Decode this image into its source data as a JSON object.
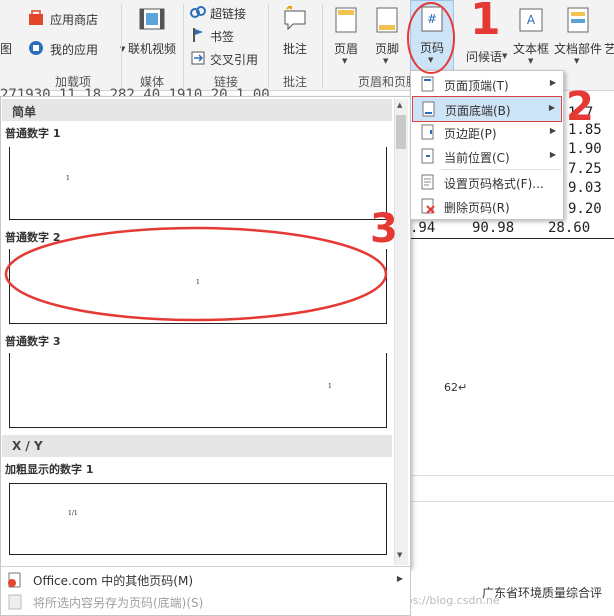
{
  "ribbon": {
    "cut_left_label": "图",
    "store": "应用商店",
    "my_apps": "我的应用",
    "addins_group": "加载项",
    "online_video": "联机视频",
    "media_group": "媒体",
    "hyperlink": "超链接",
    "bookmark": "书签",
    "cross_ref": "交叉引用",
    "links_group": "链接",
    "comment": "批注",
    "comments_group": "批注",
    "header": "页眉",
    "footer": "页脚",
    "page_number": "页码",
    "header_footer_group": "页眉和页脚",
    "greeting": "问候语",
    "textbox": "文本框",
    "quickparts": "文档部件",
    "more_cut": "艺"
  },
  "document": {
    "row1": ".94",
    "row1_b": "90.98",
    "row1_c": "28.60",
    "col_values": [
      "1.7",
      "1.85",
      "1.90",
      "7.25",
      "9.03",
      "9.20"
    ],
    "top_row": "271930.11    18,282    40    1910    20    1.00",
    "page_marker": "62↵",
    "footer_text": "广东省环境质量综合评",
    "watermark": "https://blog.csdn.ne"
  },
  "gallery": {
    "section_simple": "简单",
    "items": [
      {
        "title": "普通数字 1",
        "number": "1"
      },
      {
        "title": "普通数字 2",
        "number": "1"
      },
      {
        "title": "普通数字 3",
        "number": "1"
      }
    ],
    "section_xy": "X / Y",
    "bold_title": "加粗显示的数字 1",
    "bold_number": "1/1",
    "more_from_office": "Office.com 中的其他页码(M)",
    "save_selection": "将所选内容另存为页码(底端)(S)"
  },
  "menu": {
    "items": [
      {
        "label": "页面顶端(T)",
        "submenu": true
      },
      {
        "label": "页面底端(B)",
        "submenu": true
      },
      {
        "label": "页边距(P)",
        "submenu": true
      },
      {
        "label": "当前位置(C)",
        "submenu": true
      },
      {
        "label": "设置页码格式(F)...",
        "submenu": false
      },
      {
        "label": "删除页码(R)",
        "submenu": false
      }
    ]
  },
  "annotations": {
    "step1": "1",
    "step2": "2",
    "step3": "3",
    "color": "#e53935"
  }
}
